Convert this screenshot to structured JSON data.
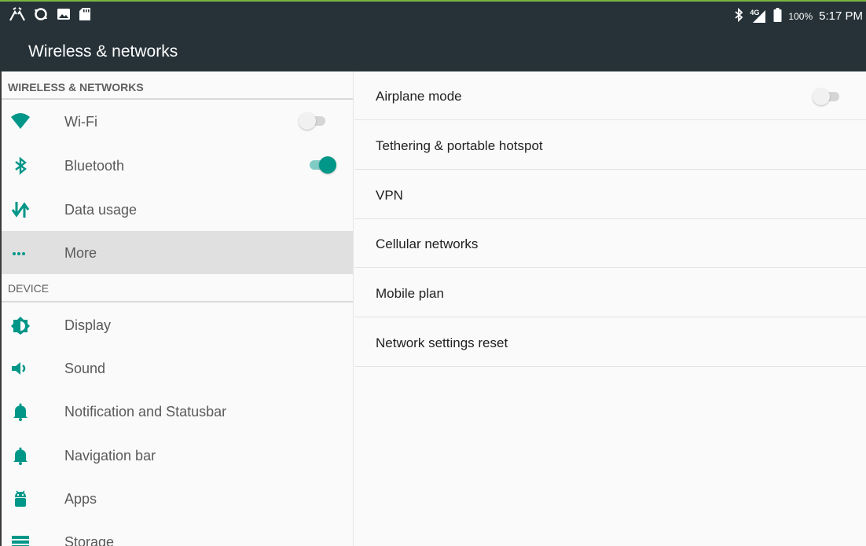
{
  "status_bar": {
    "left_icons": [
      "signal-strength-icon",
      "sync-icon",
      "image-icon",
      "sd-card-icon"
    ],
    "right_icons": [
      "bluetooth-icon",
      "lte-signal-icon",
      "battery-icon"
    ],
    "network_type": "4G",
    "battery": "100%",
    "time": "5:17 PM"
  },
  "app_bar": {
    "title": "Wireless & networks"
  },
  "colors": {
    "accent": "#009688",
    "app_bar": "#263238",
    "selected_row": "#e0e0e0"
  },
  "sidebar": {
    "wireless_header": "WIRELESS & NETWORKS",
    "device_header": "DEVICE",
    "items": [
      {
        "label": "Wi-Fi",
        "icon": "wifi-icon",
        "toggle": "off"
      },
      {
        "label": "Bluetooth",
        "icon": "bluetooth-icon",
        "toggle": "on"
      },
      {
        "label": "Data usage",
        "icon": "data-usage-icon"
      },
      {
        "label": "More",
        "icon": "more-dots-icon",
        "selected": true
      },
      {
        "label": "Display",
        "icon": "brightness-icon"
      },
      {
        "label": "Sound",
        "icon": "volume-icon"
      },
      {
        "label": "Notification and Statusbar",
        "icon": "bell-icon"
      },
      {
        "label": "Navigation bar",
        "icon": "bell-icon"
      },
      {
        "label": "Apps",
        "icon": "android-icon"
      },
      {
        "label": "Storage",
        "icon": "storage-icon"
      }
    ]
  },
  "main": {
    "items": [
      {
        "label": "Airplane mode",
        "toggle": "off"
      },
      {
        "label": "Tethering & portable hotspot"
      },
      {
        "label": "VPN"
      },
      {
        "label": "Cellular networks"
      },
      {
        "label": "Mobile plan"
      },
      {
        "label": "Network settings reset"
      }
    ]
  }
}
